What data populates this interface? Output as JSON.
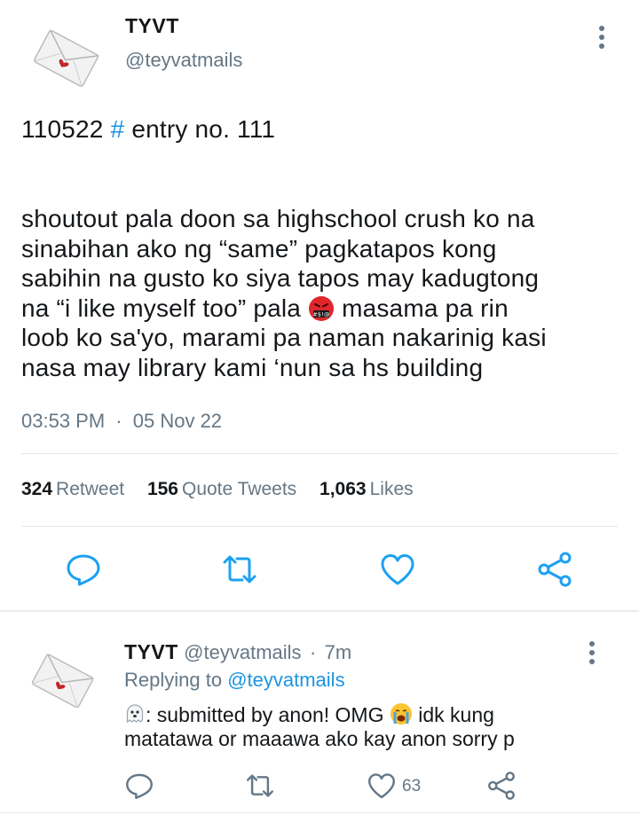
{
  "tweet": {
    "author_name": "TYVT",
    "author_handle": "@teyvatmails",
    "title_prefix": "110522",
    "title_hash": "#",
    "title_suffix": "entry no. 111",
    "body_lines": [
      "shoutout pala doon sa highschool crush ko na",
      "sinabihan ako ng “same” pagkatapos kong",
      "sabihin na gusto ko siya tapos may kadugtong",
      "na “i like myself too” pala",
      "masama pa rin",
      "loob ko sa'yo, marami pa naman nakarinig kasi",
      "nasa may library kami ‘nun sa hs building"
    ],
    "time": "03:53 PM",
    "date": "05 Nov 22",
    "separator": "·",
    "stats": {
      "retweets": "324",
      "retweets_label": "Retweet",
      "quotes": "156",
      "quotes_label": "Quote Tweets",
      "likes": "1,063",
      "likes_label": "Likes"
    }
  },
  "reply": {
    "author_name": "TYVT",
    "author_handle": "@teyvatmails",
    "separator": "·",
    "time_ago": "7m",
    "replying_prefix": "Replying to",
    "replying_handle": "@teyvatmails",
    "line1_a": ": submitted by anon! OMG",
    "line1_b": "idk kung",
    "line2": "matatawa or maaawa ako kay anon sorry p",
    "like_count": "63"
  },
  "colors": {
    "accent": "#1b95e0",
    "icon": "#1da1f2",
    "muted": "#657786",
    "divider": "#e1e8ed"
  },
  "icons": [
    "envelope-avatar",
    "kebab-icon",
    "reply-icon",
    "retweet-icon",
    "like-icon",
    "share-icon",
    "angry-emoji",
    "ghost-emoji",
    "crying-emoji"
  ]
}
